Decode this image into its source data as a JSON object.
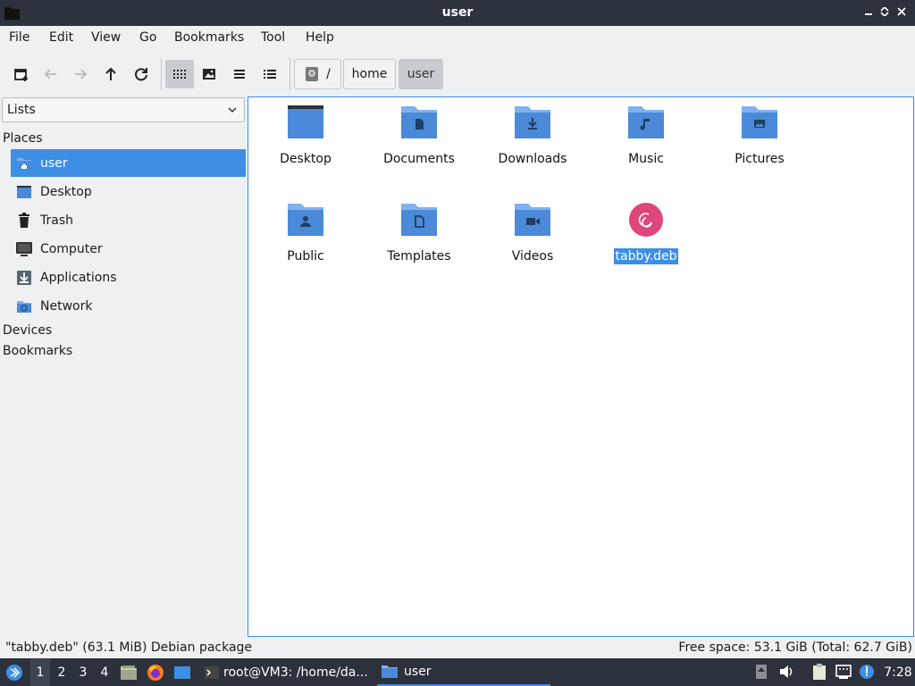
{
  "window": {
    "title": "user",
    "controls": [
      "minimize",
      "maximize",
      "close"
    ]
  },
  "menubar": {
    "items": [
      "File",
      "Edit",
      "View",
      "Go",
      "Bookmarks",
      "Tool",
      "Help"
    ]
  },
  "toolbar": {
    "buttons": [
      "new-tab",
      "back",
      "forward",
      "up",
      "reload",
      "icon-view",
      "thumbnail-view",
      "compact-view",
      "detailed-list-view"
    ],
    "active_view": "icon-view",
    "breadcrumbs": [
      {
        "label": "/",
        "icon": "drive-icon"
      },
      {
        "label": "home"
      },
      {
        "label": "user",
        "current": true
      }
    ]
  },
  "sidebar": {
    "combo": {
      "value": "Lists"
    },
    "sections": {
      "places": "Places",
      "devices": "Devices",
      "bookmarks": "Bookmarks"
    },
    "places": [
      {
        "label": "user",
        "icon": "home-folder-icon",
        "selected": true
      },
      {
        "label": "Desktop",
        "icon": "desktop-icon"
      },
      {
        "label": "Trash",
        "icon": "trash-icon"
      },
      {
        "label": "Computer",
        "icon": "computer-icon"
      },
      {
        "label": "Applications",
        "icon": "applications-icon"
      },
      {
        "label": "Network",
        "icon": "network-icon"
      }
    ]
  },
  "files": [
    {
      "name": "Desktop",
      "icon": "desktop-folder-icon"
    },
    {
      "name": "Documents",
      "icon": "documents-folder-icon"
    },
    {
      "name": "Downloads",
      "icon": "downloads-folder-icon"
    },
    {
      "name": "Music",
      "icon": "music-folder-icon"
    },
    {
      "name": "Pictures",
      "icon": "pictures-folder-icon"
    },
    {
      "name": "Public",
      "icon": "public-folder-icon"
    },
    {
      "name": "Templates",
      "icon": "templates-folder-icon"
    },
    {
      "name": "Videos",
      "icon": "videos-folder-icon"
    },
    {
      "name": "tabby.deb",
      "icon": "debian-package-icon",
      "selected": true
    }
  ],
  "statusbar": {
    "selection": "\"tabby.deb\" (63.1 MiB) Debian package",
    "space": "Free space: 53.1 GiB (Total: 62.7 GiB)"
  },
  "taskbar": {
    "workspaces": [
      "1",
      "2",
      "3",
      "4"
    ],
    "active_workspace": "1",
    "tasks": [
      {
        "label": "root@VM3: /home/da...",
        "icon": "terminal-icon"
      },
      {
        "label": "user",
        "icon": "folder-icon",
        "active": true
      }
    ],
    "clock": "7:28"
  },
  "colors": {
    "accent": "#3d8ee5",
    "folder": "#4a8ad8",
    "titlebar": "#2b323b",
    "debian": "#e0457b"
  }
}
